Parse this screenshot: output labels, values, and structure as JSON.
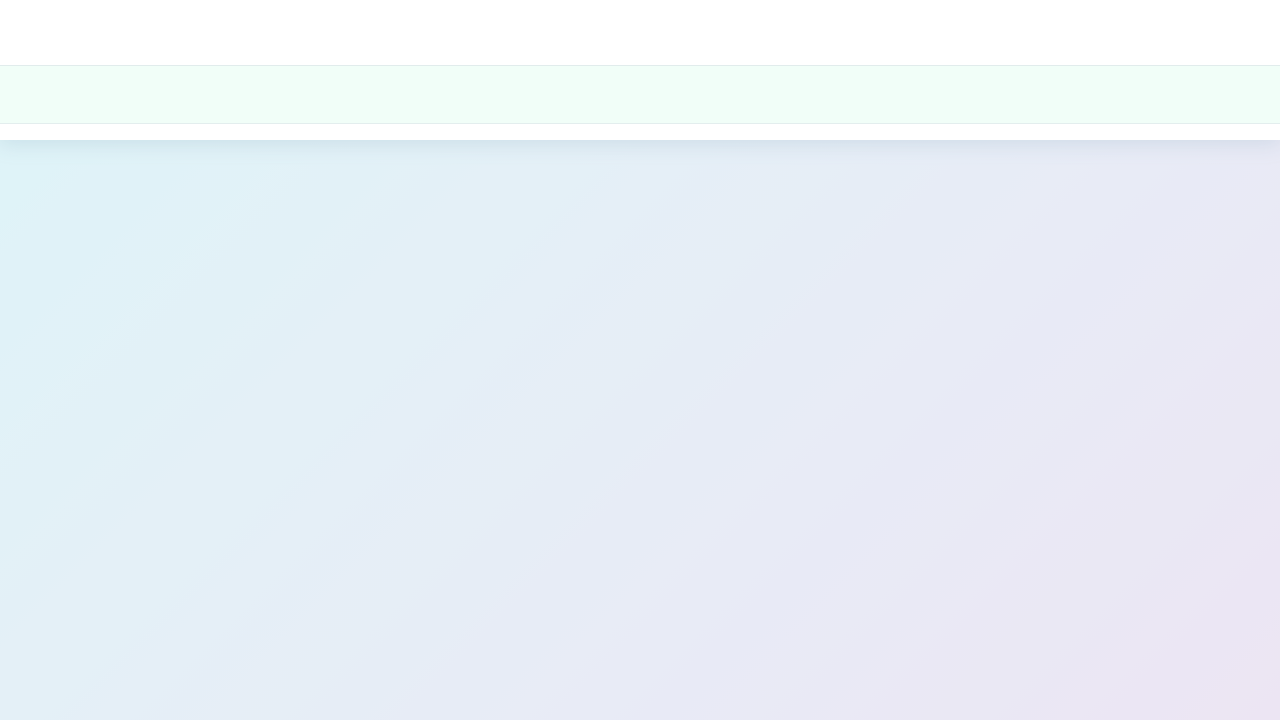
{
  "theme": {
    "header_background": "#ffffff",
    "subbar_background": "#f1fef8",
    "content_gradient": [
      "#ddf4f8",
      "#e4f0f7",
      "#e8ebf6",
      "#ece5f3"
    ]
  }
}
